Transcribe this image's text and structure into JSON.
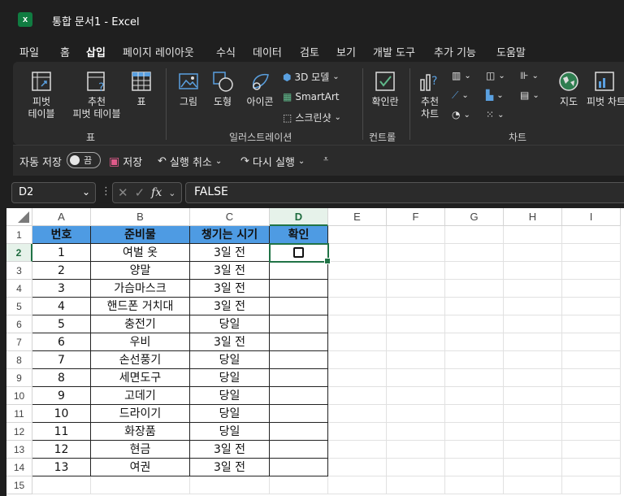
{
  "window": {
    "title": "통합 문서1  -  Excel",
    "app_icon_letter": "x"
  },
  "menu": [
    "파일",
    "홈",
    "삽입",
    "페이지 레이아웃",
    "수식",
    "데이터",
    "검토",
    "보기",
    "개발 도구",
    "추가 기능",
    "도움말"
  ],
  "active_menu": "삽입",
  "ribbon": {
    "tables": {
      "pivot": "피벗\n테이블",
      "recommended_pivot": "추천\n피벗 테이블",
      "table": "표",
      "group": "표"
    },
    "illustrations": {
      "picture": "그림",
      "shapes": "도형",
      "icons": "아이콘",
      "model3d": "3D 모델",
      "smartart": "SmartArt",
      "screenshot": "스크린샷",
      "group": "일러스트레이션"
    },
    "controls": {
      "checkbox": "확인란",
      "group": "컨트롤"
    },
    "charts": {
      "recommended": "추천\n차트",
      "map": "지도",
      "pivot_chart": "피벗 차트",
      "group": "차트"
    }
  },
  "qat": {
    "autosave": "자동 저장",
    "autosave_state": "끔",
    "save": "저장",
    "undo": "실행 취소",
    "redo": "다시 실행"
  },
  "formula_bar": {
    "name_box": "D2",
    "formula": "FALSE",
    "fx": "fx"
  },
  "columns": [
    "A",
    "B",
    "C",
    "D",
    "E",
    "F",
    "G",
    "H",
    "I"
  ],
  "header_row": [
    "번호",
    "준비물",
    "챙기는 시기",
    "확인"
  ],
  "rows": [
    [
      "1",
      "여벌 옷",
      "3일 전"
    ],
    [
      "2",
      "양말",
      "3일 전"
    ],
    [
      "3",
      "가슴마스크",
      "3일 전"
    ],
    [
      "4",
      "핸드폰 거치대",
      "3일 전"
    ],
    [
      "5",
      "충전기",
      "당일"
    ],
    [
      "6",
      "우비",
      "3일 전"
    ],
    [
      "7",
      "손선풍기",
      "당일"
    ],
    [
      "8",
      "세면도구",
      "당일"
    ],
    [
      "9",
      "고데기",
      "당일"
    ],
    [
      "10",
      "드라이기",
      "당일"
    ],
    [
      "11",
      "화장품",
      "당일"
    ],
    [
      "12",
      "현금",
      "3일 전"
    ],
    [
      "13",
      "여권",
      "3일 전"
    ]
  ],
  "row_numbers": [
    "1",
    "2",
    "3",
    "4",
    "5",
    "6",
    "7",
    "8",
    "9",
    "10",
    "11",
    "12",
    "13",
    "14",
    "15"
  ],
  "selected_cell": "D2",
  "colors": {
    "header_fill": "#4e9be3",
    "accent": "#217346"
  }
}
